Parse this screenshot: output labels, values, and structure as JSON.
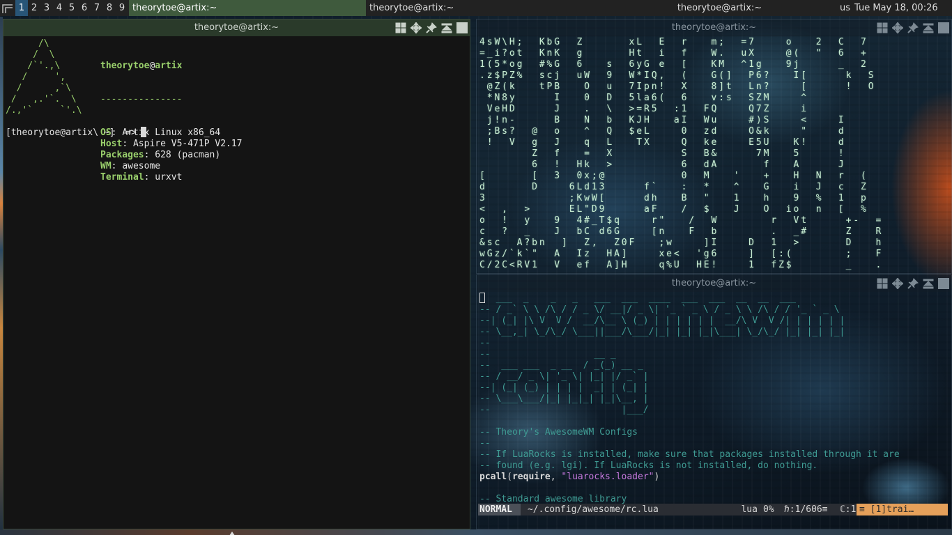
{
  "topbar": {
    "logo_icon": "awesome-launcher-icon",
    "tags": [
      "1",
      "2",
      "3",
      "4",
      "5",
      "6",
      "7",
      "8",
      "9"
    ],
    "active_tag": "1",
    "tasks": [
      "theorytoe@artix:~",
      "theorytoe@artix:~",
      "theorytoe@artix:~"
    ],
    "keyboard_layout": "us",
    "clock": "Tue May 18, 00:26"
  },
  "windows": {
    "left": {
      "title": "theorytoe@artix:~"
    },
    "top_right": {
      "title": "theorytoe@artix:~"
    },
    "bottom_right": {
      "title": "theorytoe@artix:~"
    }
  },
  "titlebar_icons": [
    "floating-icon",
    "ontop-icon",
    "sticky-icon",
    "maximize-icon",
    "close-icon"
  ],
  "neofetch": {
    "logo": "      /\\\n     /  \\\n    /`'.,\\\n   /     ',\n  /      ,`\\\n /   ,.'`.  \\\n/.,'`     `'.\\",
    "user": "theorytoe",
    "at": "@",
    "host": "artix",
    "separator": "---------------",
    "rows": [
      {
        "key": "OS",
        "value": "Artix Linux x86_64"
      },
      {
        "key": "Host",
        "value": "Aspire V5-471P V2.17"
      },
      {
        "key": "Packages",
        "value": "628 (pacman)"
      },
      {
        "key": "WM",
        "value": "awesome"
      },
      {
        "key": "Terminal",
        "value": "urxvt"
      }
    ],
    "prompt": "[theorytoe@artix\\ ~]  =>"
  },
  "matrix_lines": [
    "4sW\\H;  KbG  Z      xL  E  r   m;  =7    o   2  C  7",
    "=_i?ot  KnK  g      Ht  i  f   W.  uX    @(  \"  6  +",
    "1(5*og  #%G  6   s  6yG e  [   KM  ^1g   9j     _  2",
    ".z$PZ%  scj  uW  9  W*IQ,  (   G(]  P6?   I[     k  S",
    " @Z(k   tPB   O  u  7Ipn!  X   8]t  Ln?    [     !  O",
    " *N8y     I   0  D  5la6(  6   v:s  SZM    ^",
    " VeHD     J   .  \\  >=R5  :1  FQ    Q7Z    i",
    " j!n-     B   N  b  KJH   aI  Wu    #)S    <    I",
    " ;Bs?  @  o   ^  Q  $eL    0  zd    O&k    \"    d",
    " !  V  g  J   q  L   TX    Q  ke    E5U   K!    d",
    "       Z  f   =  X         S  B&     7M   5     !",
    "       6  !  Hk  >         6  dA      f   A     J",
    "[      [  3  0x;@          0  M   '   +   H  N  r  (",
    "d      D    6Ld13     f`   :  *   ^   G   i  J  c  Z",
    "3           ;KwW[     dh   B  \"   1   h   9  %  1  p",
    "<  ,  >     EL\"D9     aF   /  $   J   O  io  n  [  %",
    "o  !  y   9  4#_T$q    r\"   /  W       r  Vt     +-  =",
    "c  ?  _   J  bC d6G    [n   F  b       .  _#     Z   R",
    "&sc  A?bn  ]  Z,  Z0F   ;w    ]I    D  1  >      D   h",
    "wGz/`k`\"  A  Iz  HA]    xe<  'g6    ]  [:(       ;   F",
    "C/2C<RV1  V  ef  A]H    q%U  HE!    1  fZ$       _   ."
  ],
  "editor": {
    "lines": [
      {
        "type": "cursor",
        "text": "  ___  _    _   _   ___  ___  ____  ___  ___  __  __  ___"
      },
      {
        "type": "comment",
        "text": "-- / _` \\ \\ /\\ / / _ \\/ __|/ _ \\| '_ ` _ \\ / _ \\ \\ /\\ / / '_ ` _ \\"
      },
      {
        "type": "comment",
        "text": "--| (_| |\\ V  V /  __/\\__ \\ (_) | | | | | |  __/\\ V  V /| | | | | |"
      },
      {
        "type": "comment",
        "text": "-- \\__,_| \\_/\\_/ \\___||___/\\___/|_| |_| |_|\\___| \\_/\\_/ |_| |_| |_|"
      },
      {
        "type": "comment",
        "text": "--"
      },
      {
        "type": "comment",
        "text": "--                   __ _"
      },
      {
        "type": "comment",
        "text": "--  ___ ___  _ __  / _(_) __ _"
      },
      {
        "type": "comment",
        "text": "-- / __/ _ \\| '_ \\| |_| |/ _` |"
      },
      {
        "type": "comment",
        "text": "--| (_| (_) | | | |  _| | (_| |"
      },
      {
        "type": "comment",
        "text": "-- \\___\\___/|_| |_|_| |_|\\__, |"
      },
      {
        "type": "comment",
        "text": "--                        |___/"
      },
      {
        "type": "blank",
        "text": ""
      },
      {
        "type": "comment",
        "text": "-- Theory's AwesomeWM Configs"
      },
      {
        "type": "comment",
        "text": "--"
      },
      {
        "type": "comment",
        "text": "-- If LuaRocks is installed, make sure that packages installed through it are"
      },
      {
        "type": "comment",
        "text": "-- found (e.g. lgi). If LuaRocks is not installed, do nothing."
      },
      {
        "type": "code",
        "kw": "pcall",
        "p1": "(",
        "kw2": "require",
        "p2": ", ",
        "str": "\"luarocks.loader\"",
        "p3": ")"
      },
      {
        "type": "blank",
        "text": ""
      },
      {
        "type": "comment",
        "text": "-- Standard awesome library"
      }
    ],
    "status": {
      "mode": "NORMAL",
      "file": "~/.config/awesome/rc.lua",
      "filetype": "lua",
      "percent": "0%",
      "position": "ℏ:1/606≡",
      "column": "ℂ:1",
      "warning": "≡ [1]trai…"
    }
  }
}
